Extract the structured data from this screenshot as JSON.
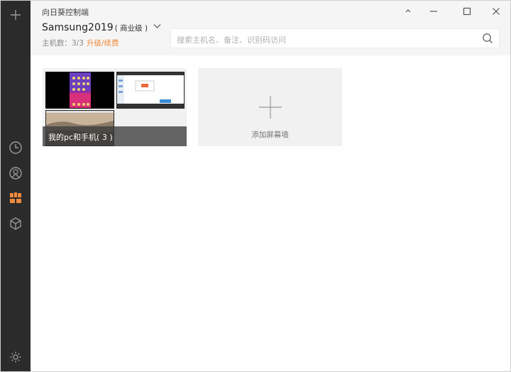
{
  "app": {
    "title": "向日葵控制端"
  },
  "account": {
    "name": "Samsung2019",
    "tier": "( 商业级 )",
    "host_count": "主机数：3/3",
    "upgrade_link": "升级/续费"
  },
  "search": {
    "placeholder": "搜索主机名、备注、识别码访问"
  },
  "groups": [
    {
      "label": "我的pc和手机( 3 )"
    }
  ],
  "add_card": {
    "label": "添加屏幕墙"
  },
  "colors": {
    "sidebar_bg": "#2b2b2b",
    "accent_orange": "#f08a3c",
    "header_bg": "#f5f5f5",
    "card_bg": "#f1f1f1"
  },
  "icons": {
    "sidebar": [
      "plus-icon",
      "clock-icon",
      "remote-icon",
      "grid-icon",
      "cube-icon",
      "gear-icon"
    ],
    "window": [
      "minimize-icon",
      "maximize-icon",
      "close-icon"
    ]
  }
}
